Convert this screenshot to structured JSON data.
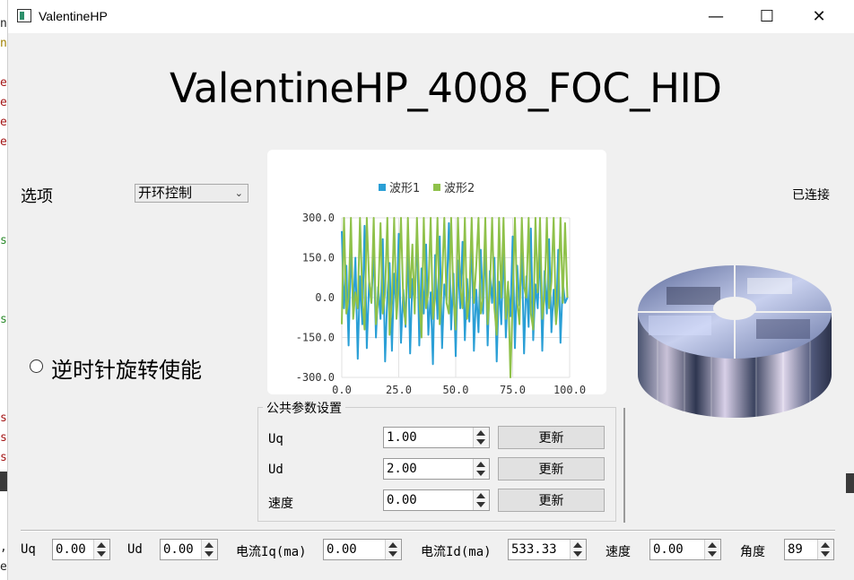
{
  "background_code": {
    "glyphs": [
      "n",
      "n",
      "e",
      "e",
      "e",
      "e",
      "s",
      "s",
      "s",
      "s",
      "s",
      ",",
      "e"
    ]
  },
  "window": {
    "title": "ValentineHP",
    "min_glyph": "—",
    "max_glyph": "☐",
    "close_glyph": "✕"
  },
  "main_title": "ValentineHP_4008_FOC_HID",
  "options": {
    "label": "选项",
    "selected": "开环控制"
  },
  "status": "已连接",
  "ccw": {
    "label": "逆时针旋转使能",
    "checked": false
  },
  "chart_data": {
    "type": "line",
    "title": "",
    "legend": [
      "波形1",
      "波形2"
    ],
    "legend_position": "top",
    "grid": true,
    "xlim": [
      0,
      100
    ],
    "ylim": [
      -300,
      300
    ],
    "x_ticks": [
      "0.0",
      "25.0",
      "50.0",
      "75.0",
      "100.0"
    ],
    "y_ticks": [
      "300.0",
      "150.0",
      "0.0",
      "-150.0",
      "-300.0"
    ],
    "series": [
      {
        "name": "波形1",
        "color": "#2a9fd6",
        "x": [
          0,
          1,
          2,
          3,
          4,
          5,
          6,
          7,
          8,
          9,
          10,
          11,
          12,
          13,
          14,
          15,
          16,
          17,
          18,
          19,
          20,
          21,
          22,
          23,
          24,
          25,
          26,
          27,
          28,
          29,
          30,
          31,
          32,
          33,
          34,
          35,
          36,
          37,
          38,
          39,
          40,
          41,
          42,
          43,
          44,
          45,
          46,
          47,
          48,
          49,
          50,
          51,
          52,
          53,
          54,
          55,
          56,
          57,
          58,
          59,
          60,
          61,
          62,
          63,
          64,
          65,
          66,
          67,
          68,
          69,
          70,
          71,
          72,
          73,
          74,
          75,
          76,
          77,
          78,
          79,
          80,
          81,
          82,
          83,
          84,
          85,
          86,
          87,
          88,
          89,
          90,
          91,
          92,
          93,
          94,
          95,
          96,
          97,
          98,
          99
        ],
        "y": [
          250,
          -40,
          120,
          -180,
          200,
          -60,
          150,
          -230,
          80,
          -100,
          270,
          -190,
          60,
          -20,
          180,
          -150,
          40,
          -80,
          220,
          -240,
          10,
          130,
          -200,
          90,
          -50,
          240,
          -170,
          30,
          -110,
          190,
          -210,
          70,
          -30,
          260,
          -180,
          110,
          -60,
          200,
          -140,
          20,
          -250,
          160,
          -80,
          230,
          -190,
          50,
          -10,
          280,
          -120,
          90,
          -220,
          140,
          -40,
          210,
          -160,
          70,
          -90,
          250,
          -200,
          30,
          -130,
          180,
          -60,
          220,
          -180,
          100,
          -20,
          150,
          -240,
          60,
          -100,
          200,
          -150,
          40,
          -70,
          230,
          -190,
          120,
          -30,
          170,
          -210,
          80,
          -110,
          260,
          -160,
          50,
          -40,
          190,
          -200,
          100,
          -60,
          220,
          -130,
          30,
          -90,
          180,
          -170,
          60,
          -20,
          0
        ]
      },
      {
        "name": "波形2",
        "color": "#8fc14a",
        "x": [
          0,
          1,
          2,
          3,
          4,
          5,
          6,
          7,
          8,
          9,
          10,
          11,
          12,
          13,
          14,
          15,
          16,
          17,
          18,
          19,
          20,
          21,
          22,
          23,
          24,
          25,
          26,
          27,
          28,
          29,
          30,
          31,
          32,
          33,
          34,
          35,
          36,
          37,
          38,
          39,
          40,
          41,
          42,
          43,
          44,
          45,
          46,
          47,
          48,
          49,
          50,
          51,
          52,
          53,
          54,
          55,
          56,
          57,
          58,
          59,
          60,
          61,
          62,
          63,
          64,
          65,
          66,
          67,
          68,
          69,
          70,
          71,
          72,
          73,
          74,
          75,
          76,
          77,
          78,
          79,
          80,
          81,
          82,
          83,
          84,
          85,
          86,
          87,
          88,
          89,
          90,
          91,
          92,
          93,
          94,
          95,
          96,
          97,
          98,
          99
        ],
        "y": [
          -100,
          300,
          -60,
          0,
          300,
          -80,
          20,
          -40,
          300,
          0,
          -120,
          300,
          60,
          -20,
          300,
          -100,
          0,
          280,
          -60,
          20,
          300,
          -140,
          0,
          300,
          -80,
          40,
          300,
          -20,
          -100,
          300,
          0,
          200,
          -60,
          300,
          0,
          -150,
          300,
          -40,
          20,
          300,
          -80,
          0,
          300,
          -100,
          60,
          300,
          -20,
          -60,
          300,
          0,
          -120,
          300,
          40,
          -40,
          300,
          -80,
          0,
          300,
          -20,
          120,
          300,
          -60,
          0,
          300,
          -100,
          20,
          300,
          -40,
          -140,
          300,
          0,
          300,
          -80,
          60,
          -300,
          0,
          300,
          -20,
          -100,
          300,
          40,
          0,
          300,
          -60,
          -120,
          300,
          20,
          300,
          -80,
          0,
          300,
          -40,
          60,
          300,
          -100,
          0,
          300,
          -20,
          280,
          0
        ]
      }
    ]
  },
  "params": {
    "title": "公共参数设置",
    "rows": [
      {
        "label": "Uq",
        "value": "1.00",
        "button": "更新"
      },
      {
        "label": "Ud",
        "value": "2.00",
        "button": "更新"
      },
      {
        "label": "速度",
        "value": "0.00",
        "button": "更新"
      }
    ]
  },
  "bottom": [
    {
      "label": "Uq",
      "value": "0.00"
    },
    {
      "label": "Ud",
      "value": "0.00"
    },
    {
      "label": "电流Iq(ma)",
      "value": "0.00"
    },
    {
      "label": "电流Id(ma)",
      "value": "533.33"
    },
    {
      "label": "速度",
      "value": "0.00"
    },
    {
      "label": "角度",
      "value": "89"
    }
  ]
}
